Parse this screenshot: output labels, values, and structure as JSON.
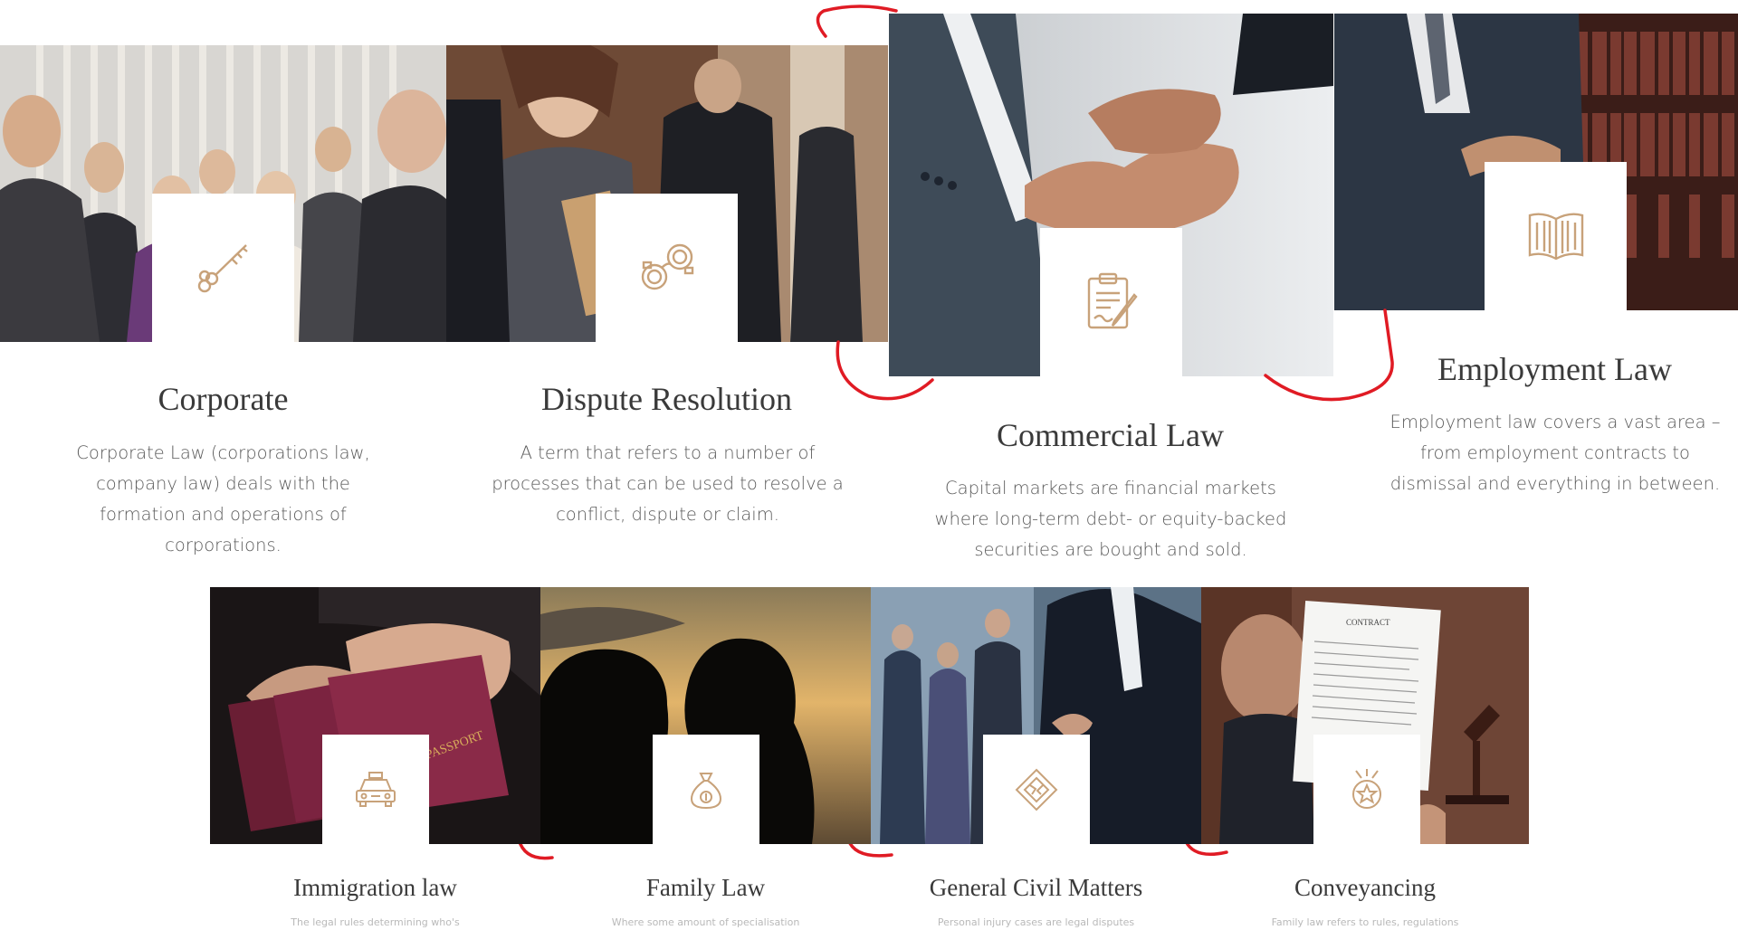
{
  "colors": {
    "accent": "#c8a27a",
    "title": "#3a3a3a",
    "text": "#5a5a5a",
    "annotation": "#e01b24"
  },
  "practice_areas": [
    {
      "title": "Corporate",
      "icon": "key-icon",
      "description": "Corporate Law (corporations law, company law) deals with the formation and operations of corporations."
    },
    {
      "title": "Dispute Resolution",
      "icon": "handcuffs-icon",
      "description": "A term that refers to a number of processes that can be used to resolve a conflict, dispute or claim."
    },
    {
      "title": "Commercial Law",
      "icon": "clipboard-pen-icon",
      "description": "Capital markets are financial markets where long-term debt- or equity-backed securities are bought and sold."
    },
    {
      "title": "Employment Law",
      "icon": "open-book-icon",
      "description": "Employment law covers a vast area – from employment contracts to dismissal and everything in between."
    },
    {
      "title": "Immigration law",
      "icon": "taxi-icon",
      "description": "The legal rules determining who's"
    },
    {
      "title": "Family Law",
      "icon": "money-bag-icon",
      "description": "Where some amount of specialisation"
    },
    {
      "title": "General Civil Matters",
      "icon": "diamond-emblem-icon",
      "description": "Personal injury cases are legal disputes"
    },
    {
      "title": "Conveyancing",
      "icon": "badge-icon",
      "description": "Family law refers to rules, regulations"
    }
  ],
  "photo_texts": {
    "contract_heading": "CONTRACT",
    "passport_label": "PASSPORT"
  }
}
